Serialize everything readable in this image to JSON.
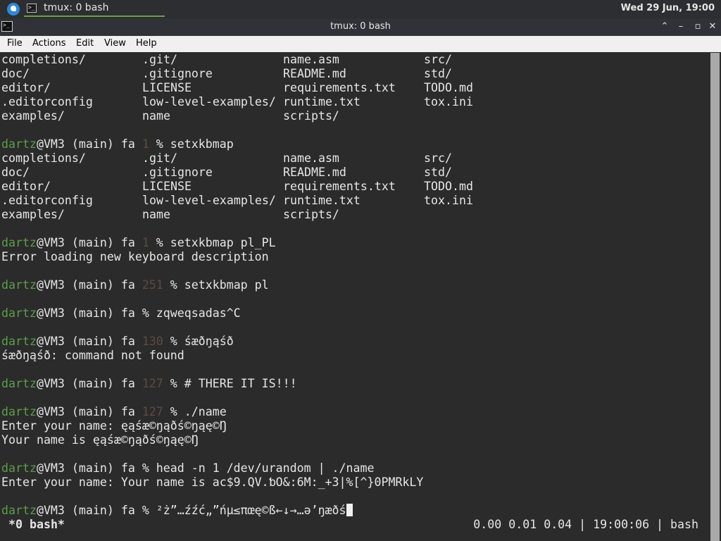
{
  "panel": {
    "task_label": "tmux: 0 bash",
    "clock": "Wed 29 Jun, 19:00"
  },
  "window": {
    "title": "tmux: 0 bash",
    "icon_glyph": ">_"
  },
  "menu": [
    "File",
    "Actions",
    "Edit",
    "View",
    "Help"
  ],
  "ls_output": [
    [
      "completions/",
      ".git/",
      "name.asm",
      "src/"
    ],
    [
      "doc/",
      ".gitignore",
      "README.md",
      "std/"
    ],
    [
      "editor/",
      "LICENSE",
      "requirements.txt",
      "TODO.md"
    ],
    [
      ".editorconfig",
      "low-level-examples/",
      "runtime.txt",
      "tox.ini"
    ],
    [
      "examples/",
      "name",
      "scripts/",
      ""
    ]
  ],
  "prompt": {
    "user": "dartz",
    "rest": "@VM3 (main) fa "
  },
  "commands": {
    "c1": {
      "status": "1 ",
      "cmd": "% setxkbmap"
    },
    "c2": {
      "status": "1 ",
      "cmd": "% setxkbmap pl_PL"
    },
    "c2_out": "Error loading new keyboard description",
    "c3": {
      "status": "251 ",
      "cmd": "% setxkbmap pl"
    },
    "c4": {
      "status": "",
      "cmd": "% zqweqsadas^C"
    },
    "c5": {
      "status": "130 ",
      "cmd": "% śæðŋąśð"
    },
    "c5_out": "śæðŋąśð: command not found",
    "c6": {
      "status": "127 ",
      "cmd": "% # THERE IT IS!!!"
    },
    "c7": {
      "status": "127 ",
      "cmd": "% ./name"
    },
    "c7_out1": "Enter your name: ęąśæ©ŋąðś©ŋąę©Ŋ",
    "c7_out2": "Your name is ęąśæ©ŋąðś©ŋąę©Ŋ",
    "c8": {
      "status": "",
      "cmd": "% head -n 1 /dev/urandom | ./name"
    },
    "c8_out": "Enter your name: Your name is ac$9.QV.ƅO&:6M:_+3|%[^}0PMRkLY",
    "c9": {
      "status": "",
      "cmd": "% ²ż”…źźć„”ńµ≤πœę©ß←↓→…ə’ŋæðś"
    }
  },
  "status": {
    "window": "*0 bash*",
    "right": "0.00 0.01 0.04 | 19:00:06 | bash"
  },
  "colors": {
    "user": "#5a9e48",
    "exit_status": "#5e4a44",
    "terminal_bg": "#2b2b2b",
    "menubar_bg": "#f0f0f0"
  }
}
